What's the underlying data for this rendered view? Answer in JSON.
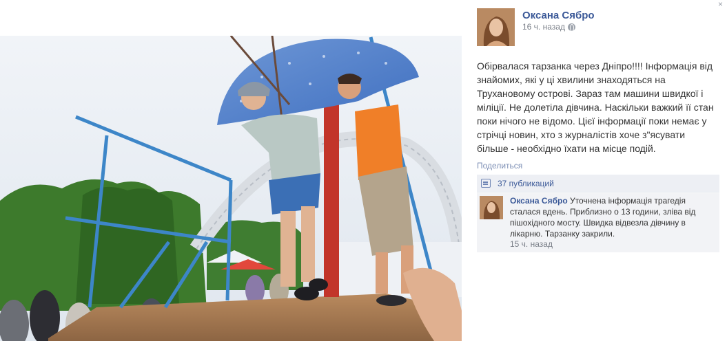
{
  "post": {
    "author": "Оксана Сябро",
    "time": "16 ч. назад",
    "text": "Обірвалася тарзанка через Дніпро!!!! Інформація від знайомих, які у ці хвилини знаходяться на Трухановому острові. Зараз там машини швидкої і міліції. Не долетіла дівчина. Наскільки важкий її стан поки нічого не відомо. Цієї інформації поки немає у стрічці новин, хто з журналістів хоче з\"ясувати більше - необхідно їхати на місце подій.",
    "share_label": "Поделиться",
    "shares_label": "37 публикаций",
    "close_symbol": "×"
  },
  "comment": {
    "author": "Оксана Сябро",
    "text": "Уточнена інформація трагедія сталася вдень. Приблизно о 13 години, зліва від пішохідного мосту. Швидка відвезла дівчину в лікарню. Тарзанку закрили.",
    "time": "15 ч. назад"
  },
  "icons": {
    "author_avatar": "profile-photo",
    "globe": "globe-icon",
    "shares": "shares-icon",
    "photo": "photo-zipline-platform"
  },
  "colors": {
    "link": "#3b5998",
    "shares_bar": "#edeff4",
    "comment_bg": "#f2f3f6"
  }
}
